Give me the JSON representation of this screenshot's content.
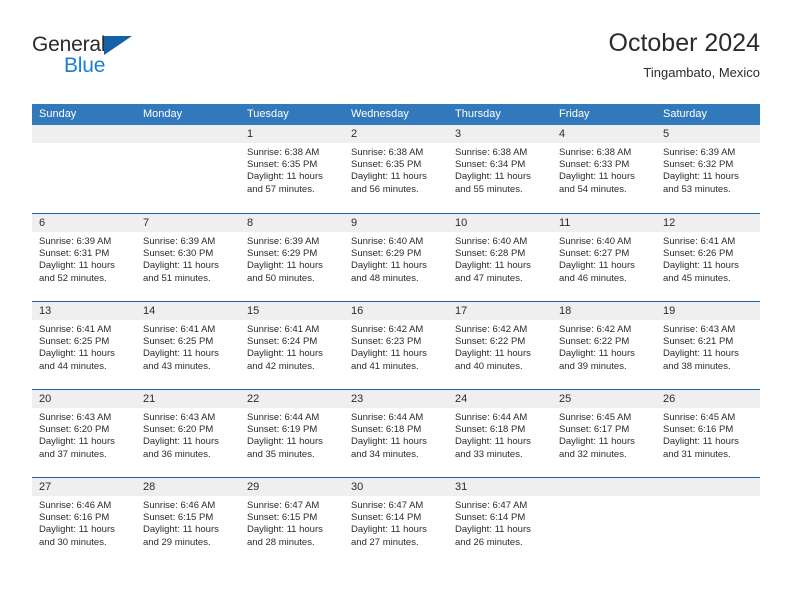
{
  "brand": {
    "name_top": "General",
    "name_bottom": "Blue",
    "accent_color": "#1a7fd4",
    "triangle_color": "#1461a8"
  },
  "header": {
    "title": "October 2024",
    "subtitle": "Tingambato, Mexico"
  },
  "theme": {
    "header_row_bg": "#3279bb",
    "week_border": "#1f5fa3",
    "day_band_bg": "#efefef",
    "text_color": "#2b2b2b"
  },
  "weekdays": [
    "Sunday",
    "Monday",
    "Tuesday",
    "Wednesday",
    "Thursday",
    "Friday",
    "Saturday"
  ],
  "weeks": [
    [
      {
        "num": "",
        "sunrise": "",
        "sunset": "",
        "daylight_line1": "",
        "daylight_line2": "",
        "empty": true
      },
      {
        "num": "",
        "sunrise": "",
        "sunset": "",
        "daylight_line1": "",
        "daylight_line2": "",
        "empty": true
      },
      {
        "num": "1",
        "sunrise": "Sunrise: 6:38 AM",
        "sunset": "Sunset: 6:35 PM",
        "daylight_line1": "Daylight: 11 hours",
        "daylight_line2": "and 57 minutes."
      },
      {
        "num": "2",
        "sunrise": "Sunrise: 6:38 AM",
        "sunset": "Sunset: 6:35 PM",
        "daylight_line1": "Daylight: 11 hours",
        "daylight_line2": "and 56 minutes."
      },
      {
        "num": "3",
        "sunrise": "Sunrise: 6:38 AM",
        "sunset": "Sunset: 6:34 PM",
        "daylight_line1": "Daylight: 11 hours",
        "daylight_line2": "and 55 minutes."
      },
      {
        "num": "4",
        "sunrise": "Sunrise: 6:38 AM",
        "sunset": "Sunset: 6:33 PM",
        "daylight_line1": "Daylight: 11 hours",
        "daylight_line2": "and 54 minutes."
      },
      {
        "num": "5",
        "sunrise": "Sunrise: 6:39 AM",
        "sunset": "Sunset: 6:32 PM",
        "daylight_line1": "Daylight: 11 hours",
        "daylight_line2": "and 53 minutes."
      }
    ],
    [
      {
        "num": "6",
        "sunrise": "Sunrise: 6:39 AM",
        "sunset": "Sunset: 6:31 PM",
        "daylight_line1": "Daylight: 11 hours",
        "daylight_line2": "and 52 minutes."
      },
      {
        "num": "7",
        "sunrise": "Sunrise: 6:39 AM",
        "sunset": "Sunset: 6:30 PM",
        "daylight_line1": "Daylight: 11 hours",
        "daylight_line2": "and 51 minutes."
      },
      {
        "num": "8",
        "sunrise": "Sunrise: 6:39 AM",
        "sunset": "Sunset: 6:29 PM",
        "daylight_line1": "Daylight: 11 hours",
        "daylight_line2": "and 50 minutes."
      },
      {
        "num": "9",
        "sunrise": "Sunrise: 6:40 AM",
        "sunset": "Sunset: 6:29 PM",
        "daylight_line1": "Daylight: 11 hours",
        "daylight_line2": "and 48 minutes."
      },
      {
        "num": "10",
        "sunrise": "Sunrise: 6:40 AM",
        "sunset": "Sunset: 6:28 PM",
        "daylight_line1": "Daylight: 11 hours",
        "daylight_line2": "and 47 minutes."
      },
      {
        "num": "11",
        "sunrise": "Sunrise: 6:40 AM",
        "sunset": "Sunset: 6:27 PM",
        "daylight_line1": "Daylight: 11 hours",
        "daylight_line2": "and 46 minutes."
      },
      {
        "num": "12",
        "sunrise": "Sunrise: 6:41 AM",
        "sunset": "Sunset: 6:26 PM",
        "daylight_line1": "Daylight: 11 hours",
        "daylight_line2": "and 45 minutes."
      }
    ],
    [
      {
        "num": "13",
        "sunrise": "Sunrise: 6:41 AM",
        "sunset": "Sunset: 6:25 PM",
        "daylight_line1": "Daylight: 11 hours",
        "daylight_line2": "and 44 minutes."
      },
      {
        "num": "14",
        "sunrise": "Sunrise: 6:41 AM",
        "sunset": "Sunset: 6:25 PM",
        "daylight_line1": "Daylight: 11 hours",
        "daylight_line2": "and 43 minutes."
      },
      {
        "num": "15",
        "sunrise": "Sunrise: 6:41 AM",
        "sunset": "Sunset: 6:24 PM",
        "daylight_line1": "Daylight: 11 hours",
        "daylight_line2": "and 42 minutes."
      },
      {
        "num": "16",
        "sunrise": "Sunrise: 6:42 AM",
        "sunset": "Sunset: 6:23 PM",
        "daylight_line1": "Daylight: 11 hours",
        "daylight_line2": "and 41 minutes."
      },
      {
        "num": "17",
        "sunrise": "Sunrise: 6:42 AM",
        "sunset": "Sunset: 6:22 PM",
        "daylight_line1": "Daylight: 11 hours",
        "daylight_line2": "and 40 minutes."
      },
      {
        "num": "18",
        "sunrise": "Sunrise: 6:42 AM",
        "sunset": "Sunset: 6:22 PM",
        "daylight_line1": "Daylight: 11 hours",
        "daylight_line2": "and 39 minutes."
      },
      {
        "num": "19",
        "sunrise": "Sunrise: 6:43 AM",
        "sunset": "Sunset: 6:21 PM",
        "daylight_line1": "Daylight: 11 hours",
        "daylight_line2": "and 38 minutes."
      }
    ],
    [
      {
        "num": "20",
        "sunrise": "Sunrise: 6:43 AM",
        "sunset": "Sunset: 6:20 PM",
        "daylight_line1": "Daylight: 11 hours",
        "daylight_line2": "and 37 minutes."
      },
      {
        "num": "21",
        "sunrise": "Sunrise: 6:43 AM",
        "sunset": "Sunset: 6:20 PM",
        "daylight_line1": "Daylight: 11 hours",
        "daylight_line2": "and 36 minutes."
      },
      {
        "num": "22",
        "sunrise": "Sunrise: 6:44 AM",
        "sunset": "Sunset: 6:19 PM",
        "daylight_line1": "Daylight: 11 hours",
        "daylight_line2": "and 35 minutes."
      },
      {
        "num": "23",
        "sunrise": "Sunrise: 6:44 AM",
        "sunset": "Sunset: 6:18 PM",
        "daylight_line1": "Daylight: 11 hours",
        "daylight_line2": "and 34 minutes."
      },
      {
        "num": "24",
        "sunrise": "Sunrise: 6:44 AM",
        "sunset": "Sunset: 6:18 PM",
        "daylight_line1": "Daylight: 11 hours",
        "daylight_line2": "and 33 minutes."
      },
      {
        "num": "25",
        "sunrise": "Sunrise: 6:45 AM",
        "sunset": "Sunset: 6:17 PM",
        "daylight_line1": "Daylight: 11 hours",
        "daylight_line2": "and 32 minutes."
      },
      {
        "num": "26",
        "sunrise": "Sunrise: 6:45 AM",
        "sunset": "Sunset: 6:16 PM",
        "daylight_line1": "Daylight: 11 hours",
        "daylight_line2": "and 31 minutes."
      }
    ],
    [
      {
        "num": "27",
        "sunrise": "Sunrise: 6:46 AM",
        "sunset": "Sunset: 6:16 PM",
        "daylight_line1": "Daylight: 11 hours",
        "daylight_line2": "and 30 minutes."
      },
      {
        "num": "28",
        "sunrise": "Sunrise: 6:46 AM",
        "sunset": "Sunset: 6:15 PM",
        "daylight_line1": "Daylight: 11 hours",
        "daylight_line2": "and 29 minutes."
      },
      {
        "num": "29",
        "sunrise": "Sunrise: 6:47 AM",
        "sunset": "Sunset: 6:15 PM",
        "daylight_line1": "Daylight: 11 hours",
        "daylight_line2": "and 28 minutes."
      },
      {
        "num": "30",
        "sunrise": "Sunrise: 6:47 AM",
        "sunset": "Sunset: 6:14 PM",
        "daylight_line1": "Daylight: 11 hours",
        "daylight_line2": "and 27 minutes."
      },
      {
        "num": "31",
        "sunrise": "Sunrise: 6:47 AM",
        "sunset": "Sunset: 6:14 PM",
        "daylight_line1": "Daylight: 11 hours",
        "daylight_line2": "and 26 minutes."
      },
      {
        "num": "",
        "sunrise": "",
        "sunset": "",
        "daylight_line1": "",
        "daylight_line2": "",
        "empty": true
      },
      {
        "num": "",
        "sunrise": "",
        "sunset": "",
        "daylight_line1": "",
        "daylight_line2": "",
        "empty": true
      }
    ]
  ]
}
